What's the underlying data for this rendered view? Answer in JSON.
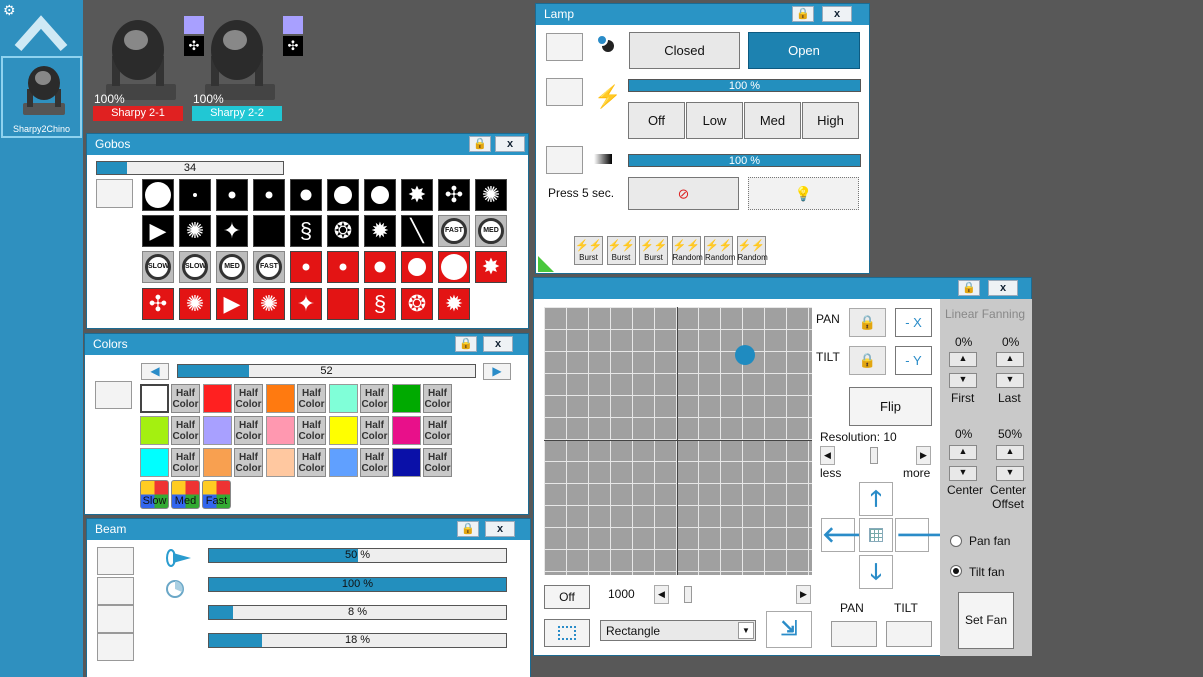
{
  "fixtures": {
    "selected": {
      "name": "Sharpy2Chino"
    },
    "items": [
      {
        "percent": "100%",
        "name": "Sharpy 2-1",
        "color": "#e02121"
      },
      {
        "percent": "100%",
        "name": "Sharpy 2-2",
        "color": "#21c7d4"
      }
    ]
  },
  "gobos": {
    "title": "Gobos",
    "lock_icon": "lock-icon",
    "close_label": "x",
    "slider_value": "34",
    "slider_fraction": 0.16,
    "rotation_labels": {
      "fast": "FAST",
      "med": "MED",
      "slow": "SLOW"
    }
  },
  "colors": {
    "title": "Colors",
    "close_label": "x",
    "slider_value": "52",
    "slider_fraction": 0.24,
    "half_label_1": "Half",
    "half_label_2": "Color",
    "swatches": [
      "#ffffff",
      "#ff2020",
      "#ff7a10",
      "#80ffd8",
      "#00aa00",
      "#a4f010",
      "#a8a0ff",
      "#ff98b0",
      "#ffff00",
      "#e8108a",
      "#00ffff",
      "#f8a050",
      "#ffc8a0",
      "#60a0ff",
      "#0a10a8"
    ],
    "wheel_labels": [
      "Slow",
      "Med",
      "Fast"
    ]
  },
  "beam": {
    "title": "Beam",
    "close_label": "x",
    "bars": [
      {
        "label": "50 %",
        "value": 0.5
      },
      {
        "label": "100 %",
        "value": 1.0
      },
      {
        "label": "8 %",
        "value": 0.08
      },
      {
        "label": "18 %",
        "value": 0.18
      }
    ]
  },
  "lamp": {
    "title": "Lamp",
    "close_label": "x",
    "closed_label": "Closed",
    "open_label": "Open",
    "dimmer": {
      "label": "100 %",
      "value": 1.0
    },
    "strobe_modes": [
      "Off",
      "Low",
      "Med",
      "High"
    ],
    "fade": {
      "label": "100 %",
      "value": 1.0
    },
    "press_label": "Press 5 sec.",
    "effects": [
      "Burst",
      "Burst",
      "Burst",
      "Random",
      "Random",
      "Random"
    ]
  },
  "position": {
    "close_label": "x",
    "pan_label": "PAN",
    "tilt_label": "TILT",
    "neg_x_label": "- X",
    "neg_y_label": "- Y",
    "flip_label": "Flip",
    "resolution_label": "Resolution: 10",
    "less_label": "less",
    "more_label": "more",
    "off_label": "Off",
    "speed_value": "1000",
    "shape_value": "Rectangle",
    "bottom_pan_label": "PAN",
    "bottom_tilt_label": "TILT",
    "fanning": {
      "title": "Linear Fanning",
      "first_value": "0%",
      "first_label": "First",
      "last_value": "0%",
      "last_label": "Last",
      "center_value": "0%",
      "center_label": "Center",
      "offset_value": "50%",
      "offset_label_1": "Center",
      "offset_label_2": "Offset",
      "pan_fan_label": "Pan fan",
      "tilt_fan_label": "Tilt fan",
      "set_fan_label": "Set Fan"
    },
    "dot_pan": 0.75,
    "dot_tilt": 0.18
  }
}
